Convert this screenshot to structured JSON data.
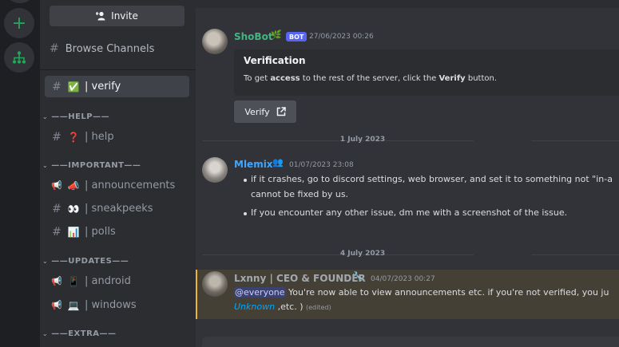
{
  "sidebar": {
    "invite_label": "Invite",
    "browse_label": "Browse Channels",
    "channels_top": [
      {
        "emoji": "✅",
        "name": "| verify",
        "active": true
      }
    ],
    "categories": [
      {
        "label": "——HELP——",
        "channels": [
          {
            "emoji": "❓",
            "name": "| help",
            "icon": "hash"
          }
        ]
      },
      {
        "label": "——IMPORTANT——",
        "channels": [
          {
            "emoji": "📣",
            "name": "| announcements",
            "icon": "megaphone"
          },
          {
            "emoji": "👀",
            "name": "| sneakpeeks",
            "icon": "hash"
          },
          {
            "emoji": "📊",
            "name": "| polls",
            "icon": "hash"
          }
        ]
      },
      {
        "label": "——UPDATES——",
        "channels": [
          {
            "emoji": "📱",
            "name": "| android",
            "icon": "megaphone"
          },
          {
            "emoji": "💻",
            "name": "| windows",
            "icon": "megaphone"
          }
        ]
      },
      {
        "label": "——EXTRA——",
        "channels": []
      }
    ]
  },
  "messages": [
    {
      "author": "ShoBot",
      "author_emoji": "🌿",
      "tag": "BOT",
      "timestamp": "27/06/2023 00:26",
      "author_color": "#43b581",
      "embed": {
        "title": "Verification",
        "text_parts": [
          "To get ",
          "access",
          " to the rest of the server, click the ",
          "Verify",
          " button."
        ]
      },
      "button_label": "Verify"
    },
    {
      "author": "Mlemix",
      "author_emoji": "👥",
      "timestamp": "01/07/2023 23:08",
      "author_color": "#3ea6ff",
      "lines": [
        "if it crashes, go to discord settings, web browser, and set it to something not \"in-a",
        "cannot be fixed by us.",
        "If you encounter any other issue, dm me with a screenshot of the issue."
      ]
    },
    {
      "author": "Lxnny | CEO & FOUNDER",
      "author_emoji": "🔧",
      "timestamp": "04/07/2023 00:27",
      "author_color": "#a3a8b0",
      "mention": "@everyone",
      "text": " You're now able to view announcements etc. if you're not verified, you ju",
      "line2_italic": "Unknown",
      "line2_rest": " ,etc. )",
      "edited": "(edited)"
    }
  ],
  "dividers": [
    "1 July 2023",
    "4 July 2023"
  ],
  "colors": {
    "accent": "#5865f2",
    "green": "#23a55a",
    "mention_highlight": "#f0b232"
  }
}
